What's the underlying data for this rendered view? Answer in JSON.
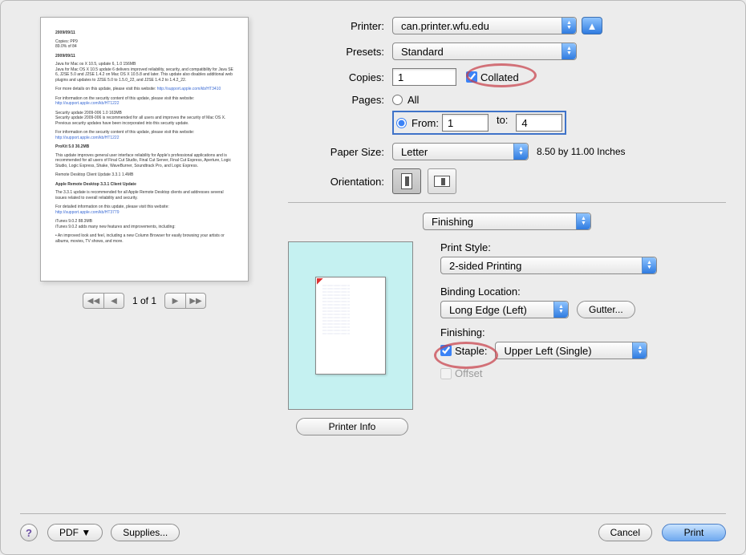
{
  "labels": {
    "printer": "Printer:",
    "presets": "Presets:",
    "copies": "Copies:",
    "collated": "Collated",
    "pages": "Pages:",
    "all": "All",
    "from": "From:",
    "to": "to:",
    "paper_size": "Paper Size:",
    "orientation": "Orientation:",
    "print_style": "Print Style:",
    "binding": "Binding Location:",
    "finishing": "Finishing:",
    "staple": "Staple:",
    "offset": "Offset",
    "printer_info": "Printer Info",
    "gutter": "Gutter...",
    "pdf": "PDF ▼",
    "supplies": "Supplies...",
    "cancel": "Cancel",
    "print": "Print"
  },
  "values": {
    "printer_select": "can.printer.wfu.edu",
    "preset_select": "Standard",
    "copies": "1",
    "collated_checked": true,
    "pages_mode": "from",
    "from": "1",
    "to_val": "4",
    "paper_size": "Letter",
    "paper_dims": "8.50 by 11.00 Inches",
    "section_select": "Finishing",
    "print_style": "2-sided Printing",
    "binding": "Long Edge (Left)",
    "staple_checked": true,
    "staple_pos": "Upper Left (Single)",
    "offset_checked": false
  },
  "pager": {
    "label": "1 of 1"
  },
  "help_glyph": "?"
}
